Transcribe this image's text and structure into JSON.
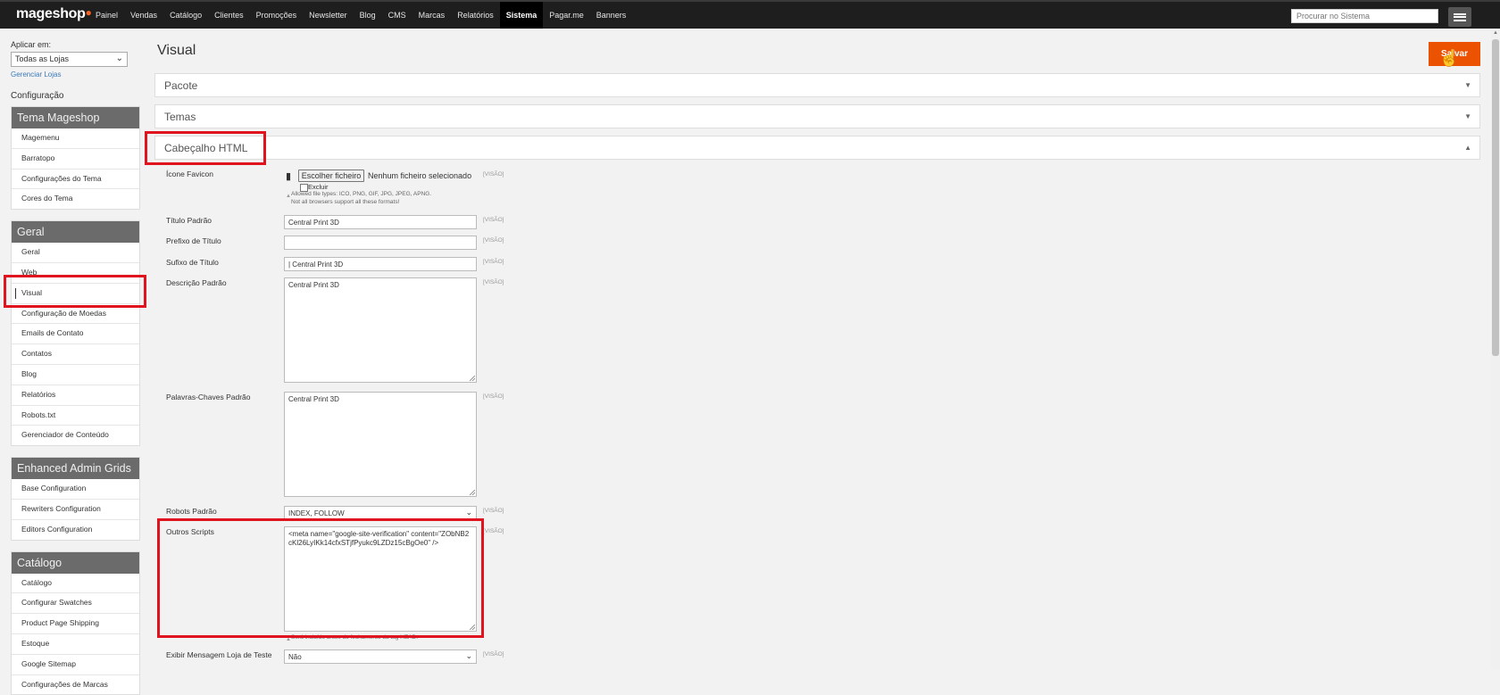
{
  "header": {
    "logo": "mageshop",
    "nav": [
      "Painel",
      "Vendas",
      "Catálogo",
      "Clientes",
      "Promoções",
      "Newsletter",
      "Blog",
      "CMS",
      "Marcas",
      "Relatórios",
      "Sistema",
      "Pagar.me",
      "Banners"
    ],
    "active_nav": "Sistema",
    "search_placeholder": "Procurar no Sistema",
    "menu_icon": "hamburger-icon"
  },
  "sidebar": {
    "apply_label": "Aplicar em:",
    "store_value": "Todas as Lojas",
    "manage_stores": "Gerenciar Lojas",
    "config_title": "Configuração",
    "groups": [
      {
        "title": "Tema Mageshop",
        "items": [
          "Magemenu",
          "Barratopo",
          "Configurações do Tema",
          "Cores do Tema"
        ]
      },
      {
        "title": "Geral",
        "items": [
          "Geral",
          "Web",
          "Visual",
          "Configuração de Moedas",
          "Emails de Contato",
          "Contatos",
          "Blog",
          "Relatórios",
          "Robots.txt",
          "Gerenciador de Conteúdo"
        ]
      },
      {
        "title": "Enhanced Admin Grids",
        "items": [
          "Base Configuration",
          "Rewriters Configuration",
          "Editors Configuration"
        ]
      },
      {
        "title": "Catálogo",
        "items": [
          "Catálogo",
          "Configurar Swatches",
          "Product Page Shipping",
          "Estoque",
          "Google Sitemap",
          "Configurações de Marcas"
        ]
      }
    ],
    "selected_item": "Visual"
  },
  "main": {
    "title": "Visual",
    "save_label": "Salvar",
    "sections": {
      "pacote": "Pacote",
      "temas": "Temas",
      "cabecalho": "Cabeçalho HTML"
    },
    "scope": "[VISÃO]",
    "favicon": {
      "label": "Ícone Favicon",
      "button": "Escolher ficheiro",
      "status": "Nenhum ficheiro selecionado",
      "excluir": "Excluir",
      "note1": "Allowed file types: ICO, PNG, GIF, JPG, JPEG, APNG.",
      "note2": "Not all browsers support all these formats!"
    },
    "titulo_padrao": {
      "label": "Título Padrão",
      "value": "Central Print 3D"
    },
    "prefixo_titulo": {
      "label": "Prefixo de Título",
      "value": ""
    },
    "sufixo_titulo": {
      "label": "Sufixo de Título",
      "value": "| Central Print 3D"
    },
    "descricao_padrao": {
      "label": "Descrição Padrão",
      "value": "Central Print 3D"
    },
    "palavras_chaves": {
      "label": "Palavras-Chaves Padrão",
      "value": "Central Print 3D"
    },
    "robots_padrao": {
      "label": "Robots Padrão",
      "value": "INDEX, FOLLOW"
    },
    "outros_scripts": {
      "label": "Outros Scripts",
      "value": "<meta name=\"google-site-verification\" content=\"ZObNB2cKl26LyIKk14cfxSTjfPyukc9LZDz15cBgOe0\" />",
      "note": "Será incluído antes do fechamento da tag HEAD."
    },
    "exibir_mensagem": {
      "label": "Exibir Mensagem Loja de Teste",
      "value": "Não"
    }
  }
}
